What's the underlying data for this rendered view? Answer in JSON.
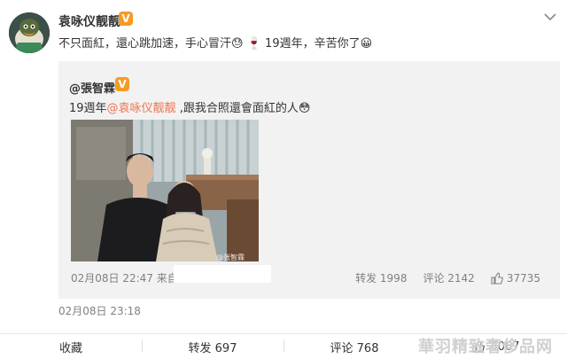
{
  "post": {
    "author_name": "袁咏仪靓靓",
    "verified_badge": "V",
    "text_part1": "不只面紅，還心跳加速，手心冒汗",
    "emoji1": "😓",
    "emoji2": "🍷",
    "text_part2": "19週年，辛苦你了",
    "emoji3": "😀",
    "timestamp": "02月08日 23:18"
  },
  "repost": {
    "author_name": "@張智霖",
    "verified_badge": "V",
    "text_prefix": "19週年",
    "mention": "@袁咏仪靓靓",
    "text_suffix": " ,跟我合照還會面紅的人",
    "emoji": "😳",
    "timestamp": "02月08日 22:47 来自",
    "photo_watermark": "@张智霖",
    "stats": {
      "forward_label": "转发 1998",
      "comment_label": "评论 2142",
      "like_count": "37735"
    }
  },
  "actions": {
    "favorite_label": "收藏",
    "forward_label": "转发 697",
    "comment_label": "评论 768",
    "like_count": "3067"
  },
  "watermark_text": "華羽精致奢侈品网",
  "colors": {
    "mention": "#eb7350",
    "badge": "#f59b22",
    "repost_bg": "#f2f2f2",
    "meta_text": "#808080"
  }
}
